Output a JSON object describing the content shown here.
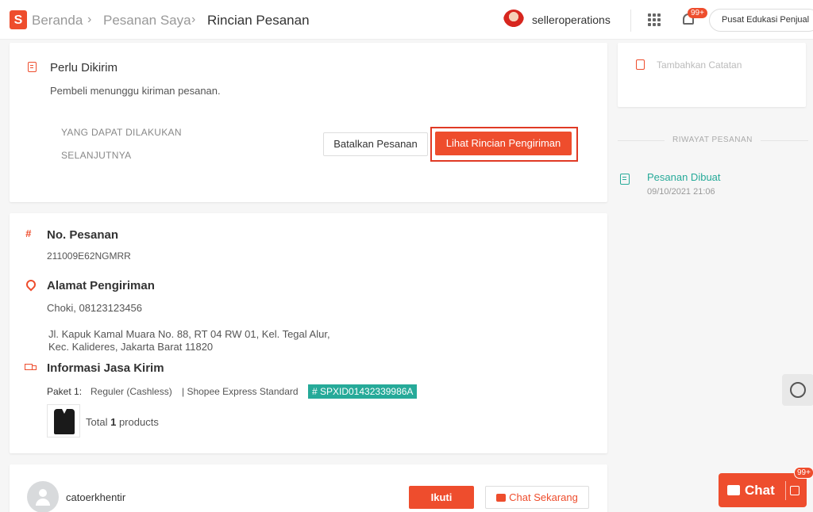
{
  "header": {
    "logo_letter": "S",
    "breadcrumb": [
      "Beranda",
      "Pesanan Saya",
      "Rincian Pesanan"
    ],
    "breadcrumb_sep": "›",
    "username": "selleroperations",
    "notification_count": "99+",
    "edu_button": "Pusat Edukasi Penjual"
  },
  "status_card": {
    "title": "Perlu Dikirim",
    "subtitle": "Pembeli menunggu kiriman pesanan.",
    "next_actions_line1": "YANG DAPAT DILAKUKAN",
    "next_actions_line2": "SELANJUTNYA",
    "cancel_button": "Batalkan Pesanan",
    "shipping_details_button": "Lihat Rincian Pengiriman"
  },
  "order_card": {
    "order_no_title": "No. Pesanan",
    "order_no": "211009E62NGMRR",
    "address_title": "Alamat Pengiriman",
    "recipient": "Choki, 08123123456",
    "address_line1": "Jl. Kapuk Kamal Muara No. 88, RT 04 RW 01, Kel. Tegal Alur,",
    "address_line2": "Kec. Kalideres, Jakarta Barat 11820",
    "shipping_title": "Informasi Jasa Kirim",
    "package_label": "Paket 1:",
    "package_service": "Reguler (Cashless)",
    "package_courier": "| Shopee Express Standard",
    "tracking_number": "# SPXID01432339986A",
    "total_prefix": "Total",
    "total_count": "1",
    "total_suffix": "products"
  },
  "buyer_card": {
    "username": "catoerkhentir",
    "follow_button": "Ikuti",
    "chat_button": "Chat Sekarang"
  },
  "sidebar": {
    "add_note": "Tambahkan Catatan",
    "history_title": "RIWAYAT PESANAN",
    "history_event": "Pesanan Dibuat",
    "history_time": "09/10/2021 21:06"
  },
  "chat_widget": {
    "label": "Chat",
    "badge": "99+"
  },
  "colors": {
    "brand": "#ee4d2d",
    "success": "#26aa99"
  }
}
